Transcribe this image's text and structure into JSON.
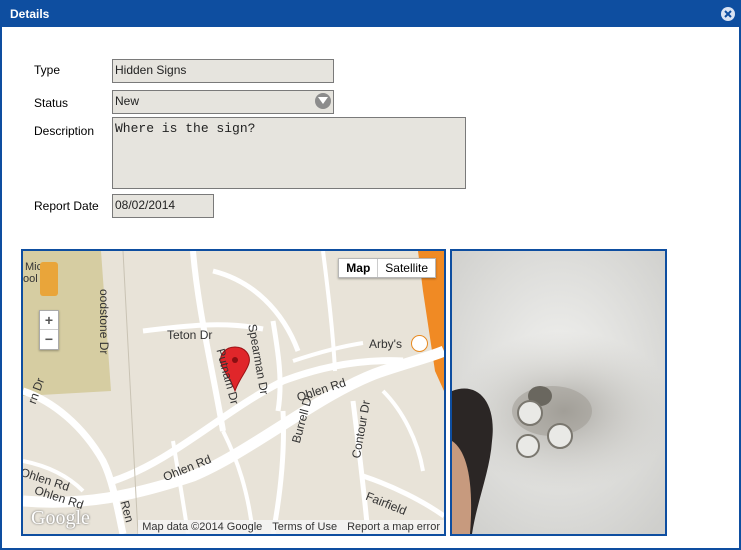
{
  "dialog": {
    "title": "Details",
    "close_icon": "close-circle-icon",
    "accent": "#0e4ea0"
  },
  "form": {
    "type_label": "Type",
    "type_value": "Hidden Signs",
    "status_label": "Status",
    "status_value": "New",
    "description_label": "Description",
    "description_value": "Where is the sign?",
    "report_date_label": "Report Date",
    "report_date_value": "08/02/2014"
  },
  "map": {
    "type_map": "Map",
    "type_satellite": "Satellite",
    "zoom_in": "+",
    "zoom_out": "−",
    "logo": "Google",
    "attribution": "Map data ©2014 Google",
    "terms": "Terms of Use",
    "report_error": "Report a map error",
    "places": {
      "micro": "Mic e",
      "micro2": "ool",
      "goodstone": "oodstone Dr",
      "teton": "Teton Dr",
      "spearman": "Spearman Dr",
      "putnam": "Putnam Dr",
      "ohlen1": "Ohlen Rd",
      "ohlen2": "Ohlen Rd",
      "ohlen3": "Ohlen Rd",
      "ohlen4": "Ohlen Rd",
      "burrell": "Burrell Dr",
      "contour": "Contour Dr",
      "fairfield": "Fairfield",
      "arbys": "Arby's",
      "ern": "rn Dr",
      "ren": "Ren"
    }
  },
  "photo": {
    "alt": "ceiling-fan-photo"
  }
}
